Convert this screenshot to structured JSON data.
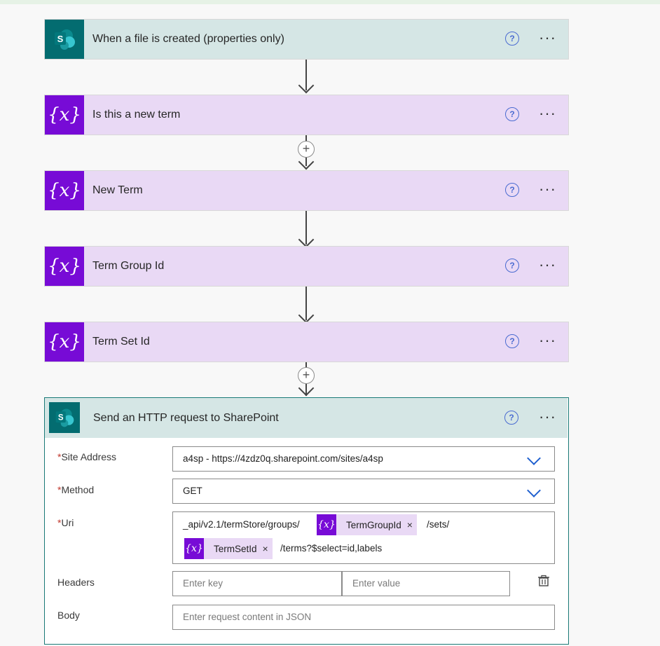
{
  "steps": [
    {
      "title": "When a file is created (properties only)",
      "icon": "sharepoint-icon"
    },
    {
      "title": "Is this a new term",
      "icon": "variable-icon"
    },
    {
      "title": "New Term",
      "icon": "variable-icon"
    },
    {
      "title": "Term Group Id",
      "icon": "variable-icon"
    },
    {
      "title": "Term Set Id",
      "icon": "variable-icon"
    }
  ],
  "http_action": {
    "title": "Send an HTTP request to SharePoint",
    "icon": "sharepoint-icon",
    "site_address": {
      "label": "Site Address",
      "required": "*",
      "value": "a4sp - https://4zdz0q.sharepoint.com/sites/a4sp"
    },
    "method": {
      "label": "Method",
      "required": "*",
      "value": "GET"
    },
    "uri": {
      "label": "Uri",
      "required": "*",
      "part1": "_api/v2.1/termStore/groups/",
      "token1": "TermGroupId",
      "part2": "/sets/",
      "token2": "TermSetId",
      "part3": "/terms?$select=id,labels"
    },
    "headers": {
      "label": "Headers",
      "key_placeholder": "Enter key",
      "value_placeholder": "Enter value"
    },
    "body": {
      "label": "Body",
      "placeholder": "Enter request content in JSON"
    }
  },
  "icons": {
    "help": "?",
    "more": "···",
    "variable": "{x}",
    "plus": "+",
    "remove": "×",
    "sp_letter": "S"
  },
  "colors": {
    "sharepoint_teal": "#036c70",
    "variable_purple": "#770bd6",
    "variable_card_bg": "#e9d9f5",
    "sharepoint_card_bg": "#d5e6e5",
    "link_blue": "#1e5fcf"
  }
}
